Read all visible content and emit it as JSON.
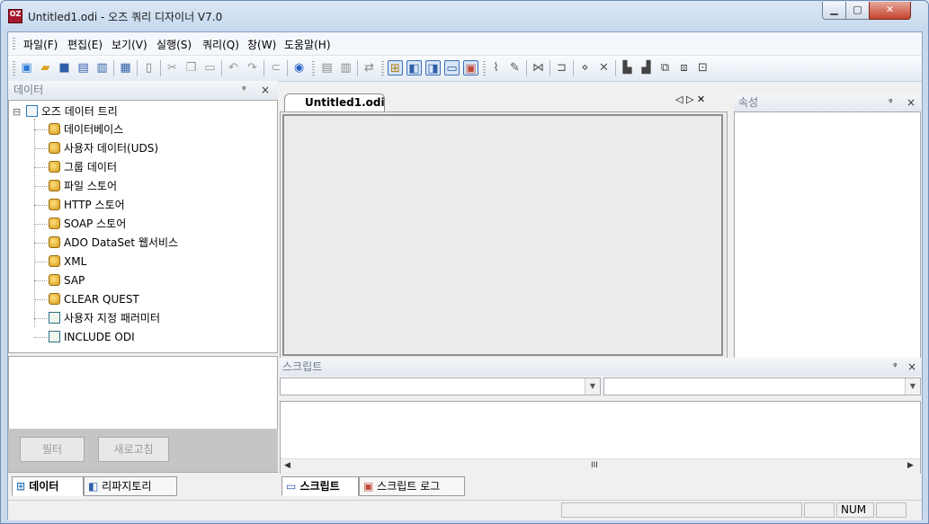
{
  "window": {
    "title": "Untitled1.odi - 오즈 쿼리 디자이너 V7.0",
    "app_icon_text": "OZ"
  },
  "menu": [
    "파일(F)",
    "편집(E)",
    "보기(V)",
    "실행(S)",
    "쿼리(Q)",
    "창(W)",
    "도움말(H)"
  ],
  "data_panel": {
    "title": "데이터",
    "tree_root": "오즈 데이터 트리",
    "items": [
      "데이터베이스",
      "사용자 데이터(UDS)",
      "그룹 데이터",
      "파일 스토어",
      "HTTP 스토어",
      "SOAP 스토어",
      "ADO DataSet 웹서비스",
      "XML",
      "SAP",
      "CLEAR QUEST",
      "사용자 지정 패러미터",
      "INCLUDE ODI"
    ],
    "filter_button": "필터",
    "refresh_button": "새로고침",
    "tabs": [
      "데이터",
      "리파지토리"
    ]
  },
  "document": {
    "tab": "Untitled1.odi",
    "nav_glyph": "◁ ▷ ✕"
  },
  "props_panel": {
    "title": "속성"
  },
  "script_panel": {
    "title": "스크립트",
    "tabs": [
      "스크립트",
      "스크립트 로그"
    ]
  },
  "status": {
    "num": "NUM"
  },
  "glyphs": {
    "pin": "ᵠ",
    "close": "×",
    "dropdown": "▼",
    "scroll_left": "◀",
    "scroll_right": "▶",
    "scroll_grip": "III",
    "expand": "⊟"
  }
}
